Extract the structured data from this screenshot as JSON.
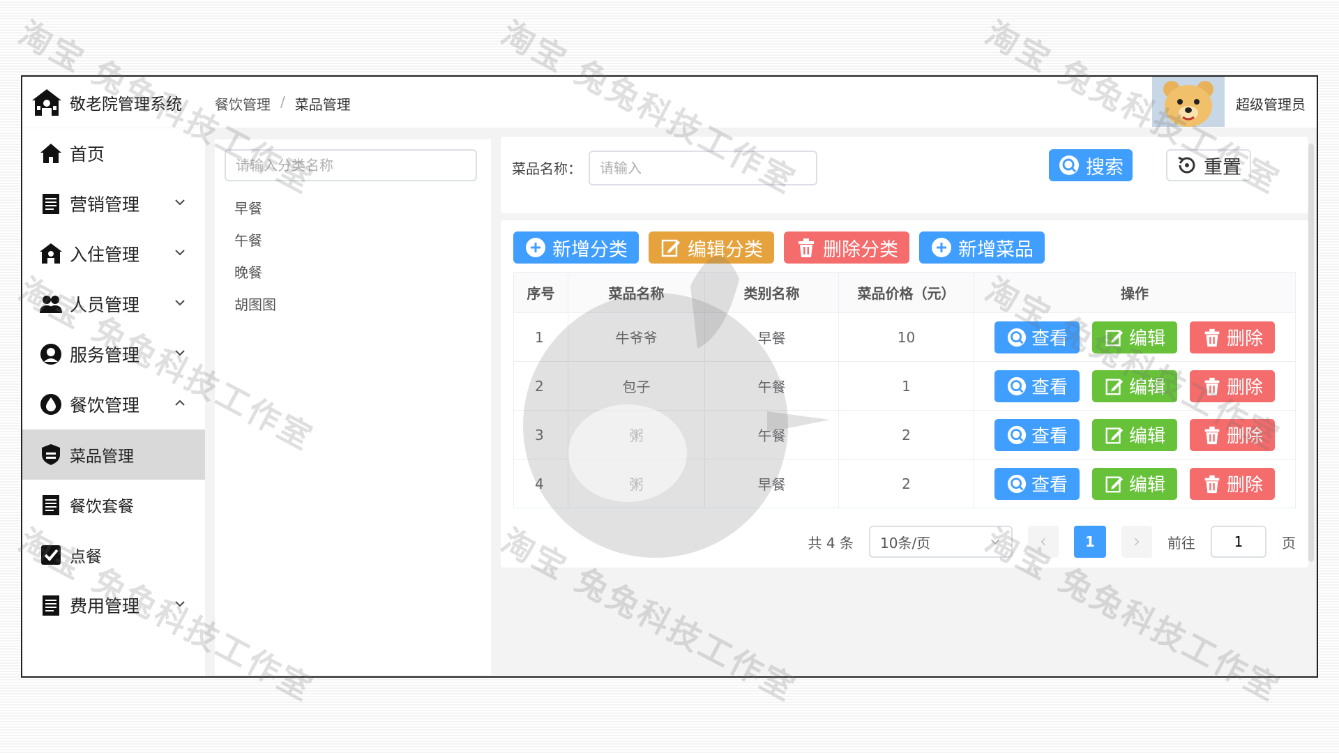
{
  "app": {
    "title": "敬老院管理系统"
  },
  "breadcrumb": {
    "parent": "餐饮管理",
    "separator": "/",
    "current": "菜品管理"
  },
  "user": {
    "name": "超级管理员"
  },
  "sidebar": {
    "items": [
      {
        "label": "首页"
      },
      {
        "label": "营销管理"
      },
      {
        "label": "入住管理"
      },
      {
        "label": "人员管理"
      },
      {
        "label": "服务管理"
      },
      {
        "label": "餐饮管理"
      },
      {
        "label": "菜品管理"
      },
      {
        "label": "餐饮套餐"
      },
      {
        "label": "点餐"
      },
      {
        "label": "费用管理"
      }
    ]
  },
  "categories": {
    "search_placeholder": "请输入分类名称",
    "items": [
      "早餐",
      "午餐",
      "晚餐",
      "胡图图"
    ]
  },
  "search": {
    "label": "菜品名称：",
    "placeholder": "请输入",
    "search_label": "搜索",
    "reset_label": "重置"
  },
  "toolbar": {
    "add_category": "新增分类",
    "edit_category": "编辑分类",
    "delete_category": "删除分类",
    "add_dish": "新增菜品"
  },
  "table": {
    "headers": [
      "序号",
      "菜品名称",
      "类别名称",
      "菜品价格（元）",
      "操作"
    ],
    "rows": [
      {
        "no": "1",
        "name": "牛爷爷",
        "category": "早餐",
        "price": "10"
      },
      {
        "no": "2",
        "name": "包子",
        "category": "午餐",
        "price": "1"
      },
      {
        "no": "3",
        "name": "粥",
        "category": "午餐",
        "price": "2"
      },
      {
        "no": "4",
        "name": "粥",
        "category": "早餐",
        "price": "2"
      }
    ],
    "actions": {
      "view": "查看",
      "edit": "编辑",
      "delete": "删除"
    }
  },
  "pagination": {
    "total_text": "共 4 条",
    "page_size": "10条/页",
    "current_page": "1",
    "goto_label": "前往",
    "goto_value": "1",
    "page_suffix": "页"
  },
  "watermark": {
    "text": "淘宝 兔兔科技工作室"
  },
  "colors": {
    "primary": "#409eff",
    "warning": "#e6a23c",
    "danger": "#f56c6c",
    "success": "#67c23a"
  }
}
